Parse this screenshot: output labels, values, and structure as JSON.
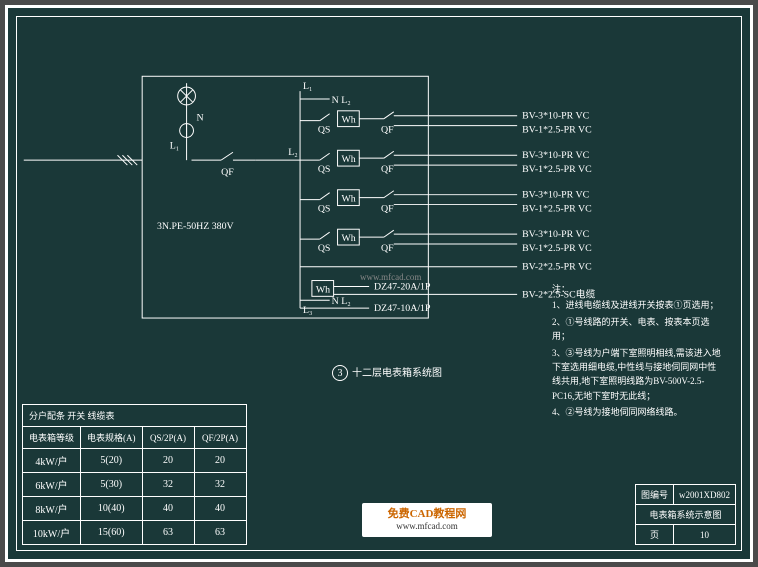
{
  "system": {
    "spec": "3N.PE-50HZ 380V",
    "qf_main": "QF",
    "line_labels": {
      "L1": "L₁",
      "L2": "L₂",
      "L3": "L₃",
      "N": "N",
      "NL2": "N L₂"
    }
  },
  "circuits": {
    "qs": "QS",
    "wh": "Wh",
    "qf": "QF",
    "row1_a": "BV-3*10-PR VC",
    "row1_b": "BV-1*2.5-PR VC",
    "row2_a": "BV-3*10-PR VC",
    "row2_b": "BV-1*2.5-PR VC",
    "row3_a": "BV-3*10-PR VC",
    "row3_b": "BV-1*2.5-PR VC",
    "row4_a": "BV-3*10-PR VC",
    "row4_b": "BV-1*2.5-PR VC",
    "row5_a": "BV-2*2.5-PR VC",
    "row6_a": "DZ47-20A/1P",
    "row6_b": "BV-2*2.5-SC电缆",
    "row7_a": "DZ47-10A/1P"
  },
  "caption": {
    "num": "3",
    "text": "十二层电表箱系统图"
  },
  "table": {
    "title": "分户配条 开关 线缆表",
    "h1": "电表箱等级",
    "h2": "电表规格(A)",
    "h3": "QS/2P(A)",
    "h4": "QF/2P(A)",
    "rows": [
      {
        "c1": "4kW/户",
        "c2": "5(20)",
        "c3": "20",
        "c4": "20"
      },
      {
        "c1": "6kW/户",
        "c2": "5(30)",
        "c3": "32",
        "c4": "32"
      },
      {
        "c1": "8kW/户",
        "c2": "10(40)",
        "c3": "40",
        "c4": "40"
      },
      {
        "c1": "10kW/户",
        "c2": "15(60)",
        "c3": "63",
        "c4": "63"
      }
    ]
  },
  "notes": {
    "title": "注：",
    "n1": "1、进线电缆线及进线开关按表①页选用；",
    "n2": "2、①号线路的开关、电表、按表本页选用；",
    "n3": "3、③号线为户端下室照明相线,需该进入地下室选用细电缆,中性线与接地伺同网中性线共用,地下室照明线路为BV-500V-2.5-PC16,无地下室时无此线；",
    "n4": "4、②号线为接地伺同网络线路。"
  },
  "titleblock": {
    "k1": "图编号",
    "v1": "w2001XD802",
    "k2": "页",
    "v2": "10",
    "name": "电表箱系统示意图"
  },
  "watermark": "www.mfcad.com",
  "logo": {
    "brand": "免费CAD教程网",
    "url": "www.mfcad.com"
  }
}
